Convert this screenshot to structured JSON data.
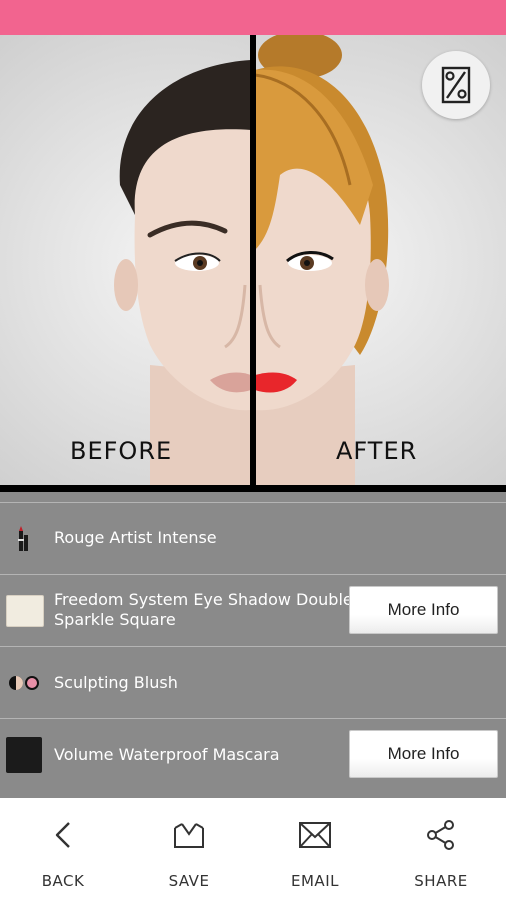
{
  "compare": {
    "before_label": "BEFORE",
    "after_label": "AFTER",
    "toggle_icon": "compare-toggle-icon"
  },
  "products": [
    {
      "name": "Rouge Artist Intense",
      "icon": "lipstick-icon",
      "more_info": ""
    },
    {
      "name_line1": "Freedom System Eye Shadow Double",
      "name_line2": "Sparkle Square",
      "icon": "eyeshadow-swatch-icon",
      "more_info": "More Info"
    },
    {
      "name": "Sculpting Blush",
      "icon": "blush-duo-icon",
      "more_info": ""
    },
    {
      "name": "Volume Waterproof Mascara",
      "icon": "mascara-icon",
      "more_info": "More Info"
    }
  ],
  "nav": {
    "back": "BACK",
    "save": "SAVE",
    "email": "EMAIL",
    "share": "SHARE"
  },
  "colors": {
    "top_bar": "#f2648f",
    "list_bg": "#8a8a8a",
    "lipstick": "#e8262b",
    "after_hair": "#c98a2e",
    "before_hair": "#2b2420"
  }
}
